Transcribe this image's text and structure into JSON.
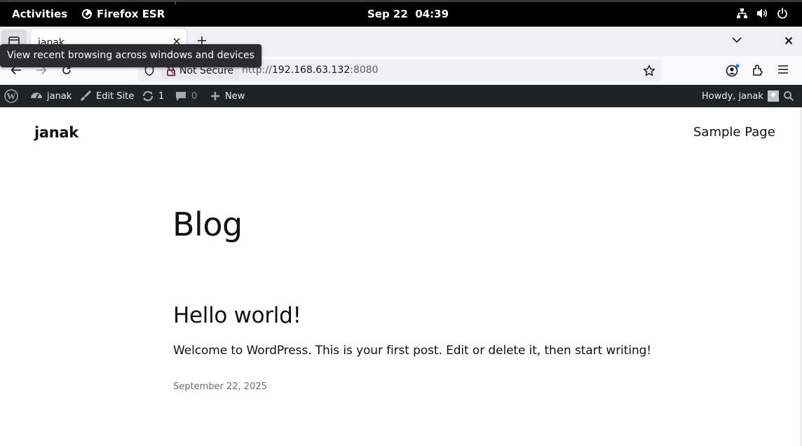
{
  "gnome": {
    "activities": "Activities",
    "app_name": "Firefox ESR",
    "date": "Sep 22",
    "time": "04:39"
  },
  "browser": {
    "tab_title": "janak",
    "tooltip": "View recent browsing across windows and devices",
    "not_secure_label": "Not Secure",
    "url_scheme": "http://",
    "url_host": "192.168.63.132",
    "url_port": ":8080"
  },
  "wp_admin_bar": {
    "site_name": "janak",
    "edit_site": "Edit Site",
    "updates_count": "1",
    "comments_count": "0",
    "new_label": "New",
    "howdy": "Howdy, janak"
  },
  "site": {
    "title": "janak",
    "nav_items": [
      "Sample Page"
    ],
    "page_heading": "Blog",
    "posts": [
      {
        "title": "Hello world!",
        "excerpt": "Welcome to WordPress. This is your first post. Edit or delete it, then start writing!",
        "date": "September 22, 2025"
      }
    ]
  },
  "colors": {
    "gnome_bar": "#000000",
    "wp_admin_bar": "#1d2327",
    "tab_strip": "#f0f0f4",
    "tooltip_bg": "#2b2a33",
    "notification_dot": "#0a84ff"
  }
}
